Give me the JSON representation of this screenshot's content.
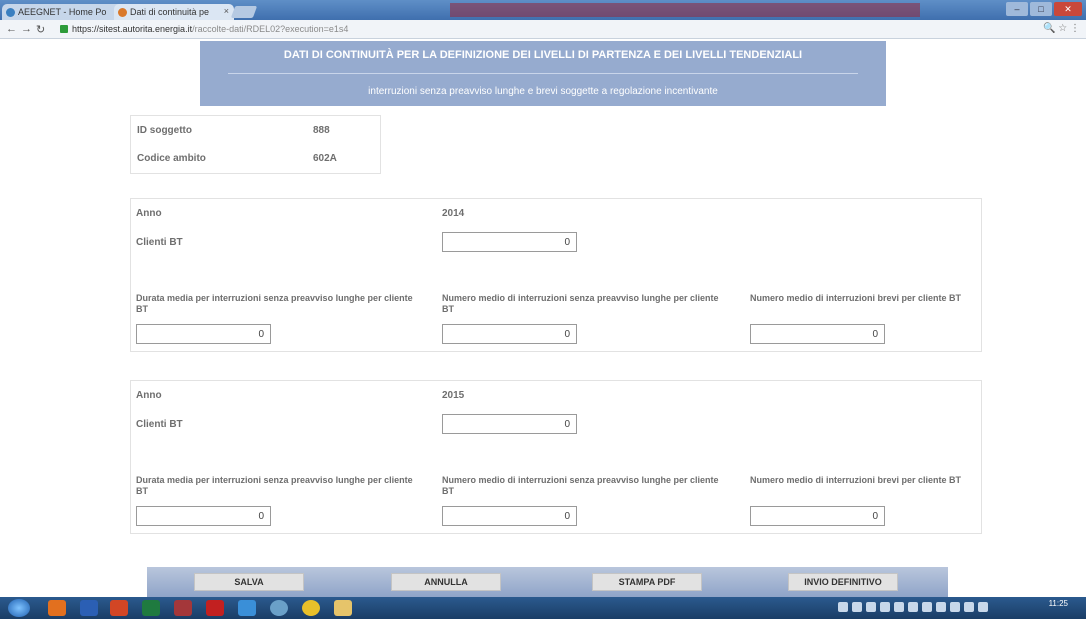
{
  "browser": {
    "tabs": [
      {
        "label": "AEEGNET - Home Po"
      },
      {
        "label": "Dati di continuità pe"
      }
    ],
    "url_host": "https://sitest.autorita.energia.it",
    "url_path": "/raccolte-dati/RDEL02?execution=e1s4"
  },
  "header": {
    "title": "DATI DI CONTINUITÀ PER LA DEFINIZIONE DEI LIVELLI DI PARTENZA E DEI LIVELLI TENDENZIALI",
    "subtitle": "interruzioni senza preavviso lunghe e brevi soggette a regolazione incentivante"
  },
  "ident": {
    "id_label": "ID soggetto",
    "id_value": "888",
    "ambito_label": "Codice ambito",
    "ambito_value": "602A"
  },
  "years": [
    {
      "anno_label": "Anno",
      "anno": "2014",
      "clienti_label": "Clienti BT",
      "clienti_value": "0",
      "durata_label": "Durata media per interruzioni senza preavviso lunghe per cliente BT",
      "durata_value": "0",
      "numero_lunghe_label": "Numero medio di interruzioni senza preavviso lunghe per cliente BT",
      "numero_lunghe_value": "0",
      "numero_brevi_label": "Numero medio di interruzioni brevi per cliente BT",
      "numero_brevi_value": "0"
    },
    {
      "anno_label": "Anno",
      "anno": "2015",
      "clienti_label": "Clienti BT",
      "clienti_value": "0",
      "durata_label": "Durata media per interruzioni senza preavviso lunghe per cliente BT",
      "durata_value": "0",
      "numero_lunghe_label": "Numero medio di interruzioni senza preavviso lunghe per cliente BT",
      "numero_lunghe_value": "0",
      "numero_brevi_label": "Numero medio di interruzioni brevi per cliente BT",
      "numero_brevi_value": "0"
    }
  ],
  "buttons": {
    "salva": "SALVA",
    "annulla": "ANNULLA",
    "stampa": "STAMPA PDF",
    "invio": "INVIO DEFINITIVO"
  },
  "taskbar": {
    "time": "11:25"
  },
  "colors": {
    "header_bg": "#96abcf",
    "label_text": "#6e6e6e"
  }
}
